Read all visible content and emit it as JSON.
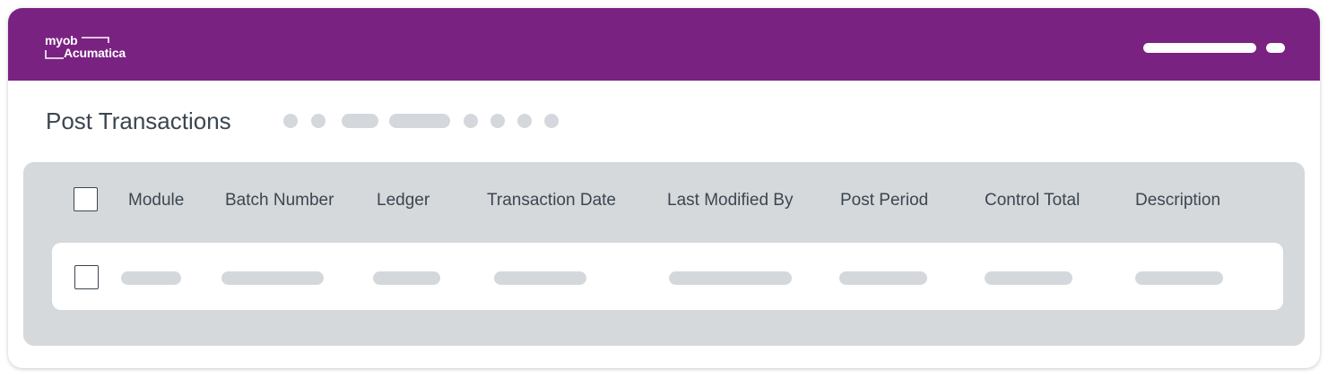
{
  "app": {
    "logo_line1": "myob",
    "logo_line2": "Acumatica",
    "brand_color": "#7a2282"
  },
  "page": {
    "title": "Post Transactions"
  },
  "grid": {
    "columns": [
      "Module",
      "Batch Number",
      "Ledger",
      "Transaction Date",
      "Last Modified By",
      "Post Period",
      "Control Total",
      "Description"
    ]
  }
}
